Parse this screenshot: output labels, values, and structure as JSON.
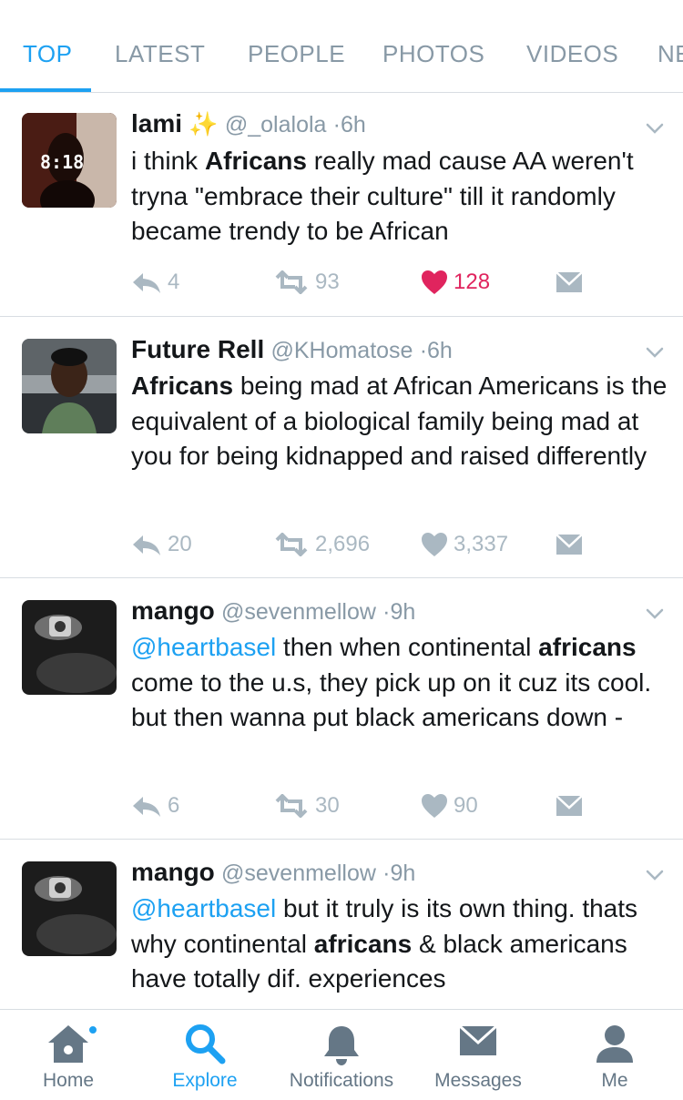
{
  "tabs": [
    {
      "label": "TOP",
      "active": true
    },
    {
      "label": "LATEST",
      "active": false
    },
    {
      "label": "PEOPLE",
      "active": false
    },
    {
      "label": "PHOTOS",
      "active": false
    },
    {
      "label": "VIDEOS",
      "active": false
    },
    {
      "label": "NE",
      "active": false
    }
  ],
  "tweets": [
    {
      "name": "lami",
      "sparkle": "✨",
      "handle": "@_olalola",
      "time": "6h",
      "avatar_text": "8:18",
      "actions": {
        "replies": "4",
        "retweets": "93",
        "likes": "128",
        "liked": true
      }
    },
    {
      "name": "Future Rell",
      "handle": "@KHomatose",
      "time": "6h",
      "actions": {
        "replies": "20",
        "retweets": "2,696",
        "likes": "3,337",
        "liked": false
      }
    },
    {
      "name": "mango",
      "handle": "@sevenmellow",
      "time": "9h",
      "mention": "@heartbasel",
      "actions": {
        "replies": "6",
        "retweets": "30",
        "likes": "90",
        "liked": false
      }
    },
    {
      "name": "mango",
      "handle": "@sevenmellow",
      "time": "9h",
      "mention": "@heartbasel"
    }
  ],
  "tweet_text": {
    "t1_a": "i think ",
    "t1_b": "Africans",
    "t1_c": " really mad cause AA weren't tryna \"embrace their culture\" till it randomly became trendy to be African",
    "t2_b": "Africans",
    "t2_c": " being mad at African Americans is the equivalent of a biological family being mad at you for being kidnapped and raised differently",
    "t3_a": " then when continental ",
    "t3_b": "africans",
    "t3_c": " come to the u.s, they pick up on it cuz its cool. but then wanna put black americans down -",
    "t4_a": " but it truly is its own thing. thats why continental ",
    "t4_b": "africans",
    "t4_c": " & black americans have totally dif. experiences"
  },
  "separator": "·",
  "nav": [
    {
      "label": "Home",
      "icon": "home-icon"
    },
    {
      "label": "Explore",
      "icon": "search-icon",
      "active": true
    },
    {
      "label": "Notifications",
      "icon": "bell-icon"
    },
    {
      "label": "Messages",
      "icon": "envelope-icon"
    },
    {
      "label": "Me",
      "icon": "person-icon"
    }
  ],
  "colors": {
    "accent": "#1da1f2",
    "like": "#e0245e",
    "muted": "#8899a6",
    "action_gray": "#aab8c2"
  }
}
